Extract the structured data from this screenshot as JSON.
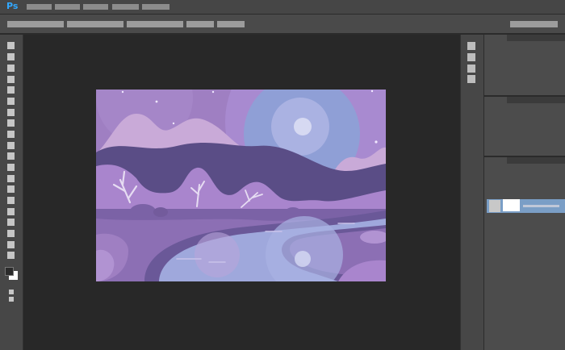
{
  "app": {
    "logo_text": "Ps",
    "logo_color": "#31a8ff"
  },
  "colors": {
    "menubar": "#464646",
    "panel": "#474747",
    "workspace": "#282828",
    "selected_layer": "#7a9ec6",
    "canvas_sky": "#9f7fc2",
    "moon": "#8f9fd6"
  },
  "menubar": {
    "item_count": 5
  },
  "tools": {
    "icon_names": [
      "move-tool",
      "marquee-tool",
      "lasso-tool",
      "quick-select-tool",
      "crop-tool",
      "eyedropper-tool",
      "healing-brush-tool",
      "brush-tool",
      "clone-stamp-tool",
      "history-brush-tool",
      "eraser-tool",
      "gradient-tool",
      "blur-tool",
      "dodge-tool",
      "pen-tool",
      "type-tool",
      "path-select-tool",
      "shape-tool",
      "hand-tool",
      "zoom-tool"
    ]
  },
  "layers": {
    "selected_index": 0
  },
  "canvas": {
    "description_icon": "night-landscape-illustration"
  }
}
